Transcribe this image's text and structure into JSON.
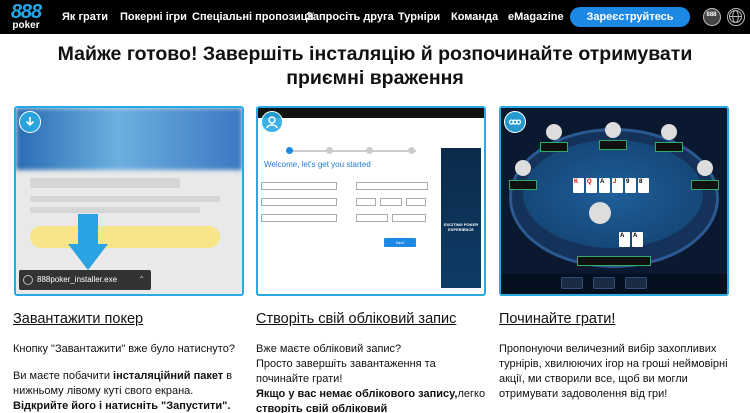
{
  "nav": {
    "logo_top": "888",
    "logo_bottom": "poker",
    "links": [
      "Як грати",
      "Покерні ігри",
      "Спеціальні пропозиції",
      "Запросіть друга",
      "Турніри",
      "Команда",
      "eMagazine"
    ],
    "register_label": "Зареєструйтесь",
    "account_icon": "account-icon",
    "globe_icon": "globe-icon"
  },
  "headline": {
    "line1": "Майже готово! Завершіть інсталяцію й розпочинайте отримувати",
    "line2": "приємні враження"
  },
  "panels": {
    "download": {
      "badge_icon": "download-icon",
      "installer_filename": "888poker_installer.exe"
    },
    "signup": {
      "badge_icon": "user-icon",
      "form_title": "Welcome, let's get you started",
      "next_label": "Next",
      "ad_text": "EXCITING POKER EXPERIENCE"
    },
    "play": {
      "badge_icon": "888-icon"
    }
  },
  "steps": [
    {
      "title": "Завантажити покер",
      "p1": "Кнопку \"Завантажити\" вже було натиснуто?",
      "p2_a": "Ви маєте побачити ",
      "p2_b": "інсталяційний пакет",
      "p2_c": " в нижньому лівому куті свого екрана.",
      "p2_d": "Відкрийте його і натисніть \"Запустити\"."
    },
    {
      "title": "Створіть свій обліковий запис",
      "p1": "Вже маєте обліковий запис?",
      "p2": "Просто завершіть завантаження та починайте грати!",
      "p3_a": "Якщо у вас немає облікового запису,",
      "p3_b": "легко ",
      "p3_c": "створіть свій обліковий"
    },
    {
      "title": "Починайте грати!",
      "p1": "Пропонуючи величезний вибір захопливих турнірів, хвилюючих ігор на гроші неймовірні акції, ми створили все, щоб ви могли отримувати задоволення від гри!"
    }
  ],
  "colors": {
    "accent": "#27a9e1",
    "register": "#1e88e5",
    "nav_bg": "#000000"
  }
}
